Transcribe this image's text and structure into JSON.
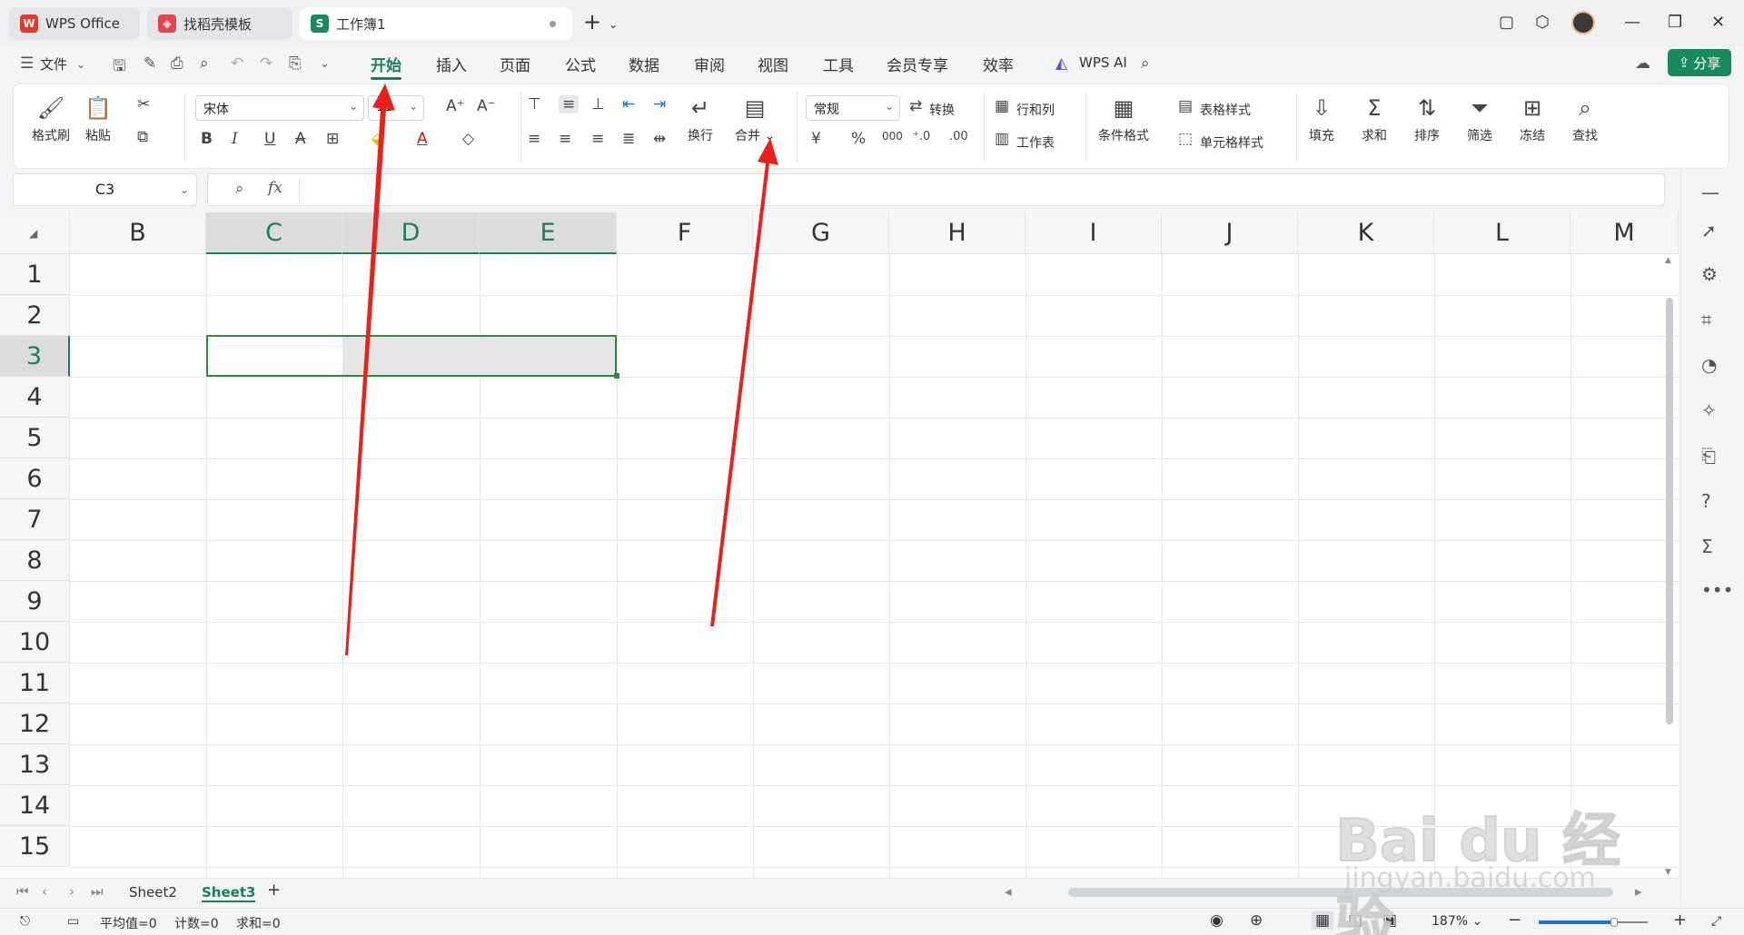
{
  "titlebar": {
    "tabs": [
      {
        "label": "WPS Office",
        "logo": "W",
        "logo_color": "#e03a2e"
      },
      {
        "label": "找稻壳模板",
        "logo": "◈",
        "logo_color": "#e0464a"
      },
      {
        "label": "工作簿1",
        "logo": "S",
        "logo_color": "#1a8a5e",
        "active": true
      }
    ],
    "new_tab": "+"
  },
  "menubar": {
    "file_label": "文件",
    "tabs": [
      "开始",
      "插入",
      "页面",
      "公式",
      "数据",
      "审阅",
      "视图",
      "工具",
      "会员专享",
      "效率"
    ],
    "active_tab": "开始",
    "wps_ai_label": "WPS AI",
    "share_label": "分享"
  },
  "ribbon": {
    "format_painter": "格式刷",
    "paste": "粘贴",
    "font_name": "宋体",
    "font_size": "11",
    "wrap_text": "换行",
    "merge": "合并",
    "number_format": "常规",
    "convert": "转换",
    "rows_cols": "行和列",
    "worksheet": "工作表",
    "cond_format": "条件格式",
    "table_style": "表格样式",
    "cell_style": "单元格样式",
    "fill": "填充",
    "sum": "求和",
    "sort": "排序",
    "filter": "筛选",
    "freeze": "冻结",
    "find": "查找",
    "bold": "B",
    "italic": "I",
    "underline": "U",
    "strike": "A",
    "font_color": "A",
    "currency": "¥",
    "percent": "%",
    "thousands": "000"
  },
  "formula_bar": {
    "name_box": "C3",
    "fx": "fx"
  },
  "grid": {
    "columns": [
      "B",
      "C",
      "D",
      "E",
      "F",
      "G",
      "H",
      "I",
      "J",
      "K",
      "L",
      "M"
    ],
    "selected_columns": [
      "C",
      "D",
      "E"
    ],
    "rows": [
      "1",
      "2",
      "3",
      "4",
      "5",
      "6",
      "7",
      "8",
      "9",
      "10",
      "11",
      "12",
      "13",
      "14",
      "15"
    ],
    "selected_row": "3"
  },
  "sheets": {
    "tabs": [
      "Sheet2",
      "Sheet3"
    ],
    "active": "Sheet3",
    "add": "+"
  },
  "statusbar": {
    "average": "平均值=0",
    "count": "计数=0",
    "sum": "求和=0",
    "zoom": "187%",
    "zoom_fraction": 0.68
  },
  "watermark": {
    "text": "Bai du 经验",
    "sub": "jingyan.baidu.com"
  },
  "colors": {
    "accent": "#1a7f5a",
    "selection_border": "#2e8b3a",
    "annotation_arrow": "#e8211d"
  }
}
